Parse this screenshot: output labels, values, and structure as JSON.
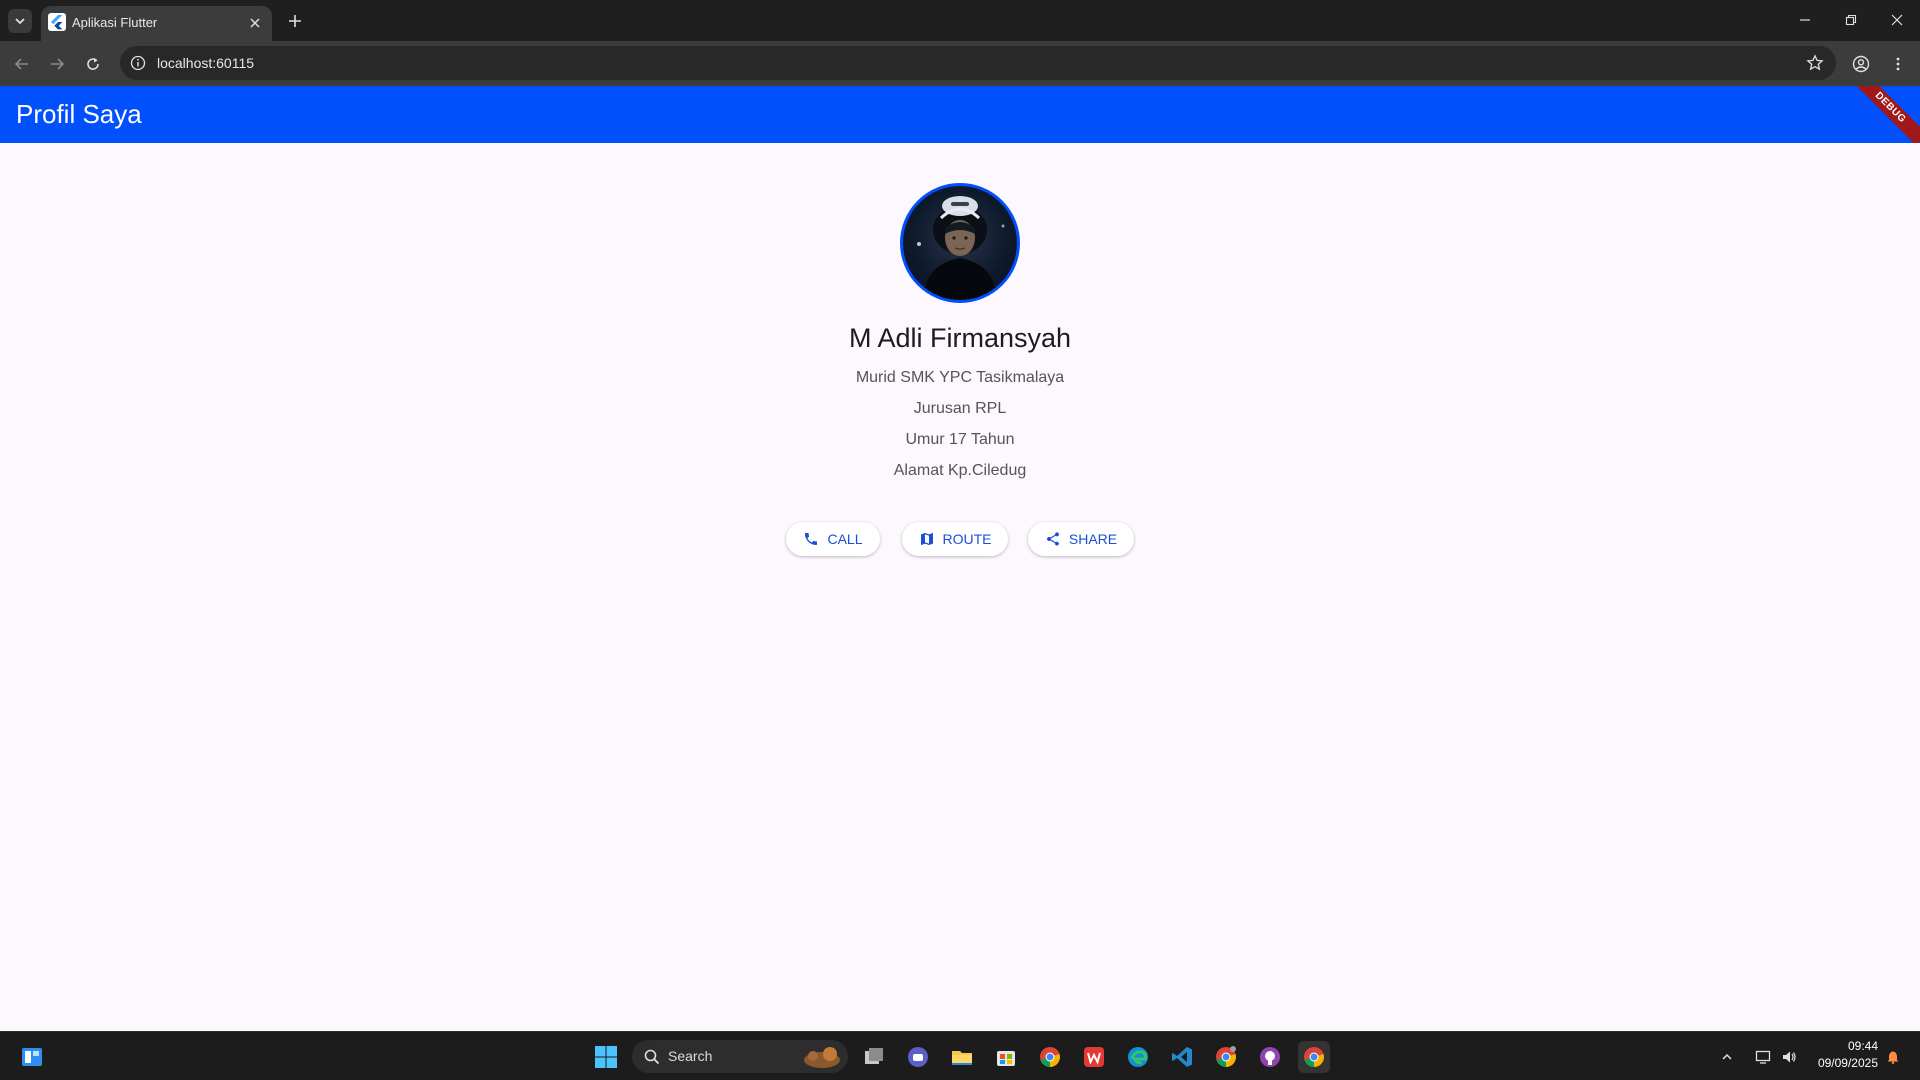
{
  "browser": {
    "tab_title": "Aplikasi Flutter",
    "url": "localhost:60115"
  },
  "app": {
    "title": "Profil Saya",
    "debug_banner": "DEBUG"
  },
  "profile": {
    "name": "M Adli Firmansyah",
    "lines": [
      "Murid SMK YPC Tasikmalaya",
      "Jurusan RPL",
      "Umur 17 Tahun",
      "Alamat Kp.Ciledug"
    ]
  },
  "actions": {
    "call": "CALL",
    "route": "ROUTE",
    "share": "SHARE"
  },
  "taskbar": {
    "search_label": "Search",
    "time": "09:44",
    "date": "09/09/2025"
  },
  "colors": {
    "appbar": "#0050fe",
    "background": "#fdf7fe",
    "button_text": "#1d4ed8"
  }
}
